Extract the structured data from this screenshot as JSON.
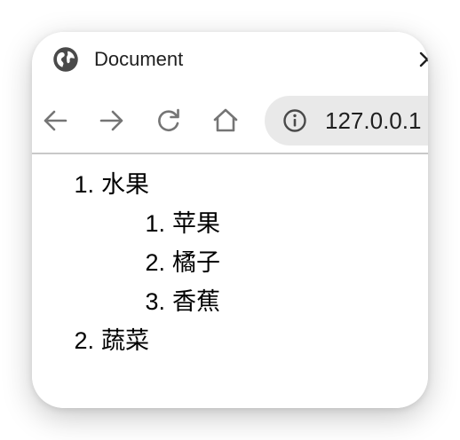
{
  "tab": {
    "title": "Document",
    "favicon": "globe-icon",
    "close_icon": "close-icon"
  },
  "toolbar": {
    "back_icon": "arrow-left-icon",
    "forward_icon": "arrow-right-icon",
    "reload_icon": "reload-icon",
    "home_icon": "home-icon",
    "address": {
      "info_icon": "info-icon",
      "url": "127.0.0.1"
    }
  },
  "page": {
    "list": [
      {
        "marker": "1.",
        "text": "水果",
        "children": [
          {
            "marker": "1.",
            "text": "苹果"
          },
          {
            "marker": "2.",
            "text": "橘子"
          },
          {
            "marker": "3.",
            "text": "香蕉"
          }
        ]
      },
      {
        "marker": "2.",
        "text": "蔬菜"
      }
    ]
  },
  "colors": {
    "window_bg": "#ffffff",
    "omnibox_bg": "#e9e9e9",
    "icon_gray": "#757575",
    "text": "#000000"
  }
}
